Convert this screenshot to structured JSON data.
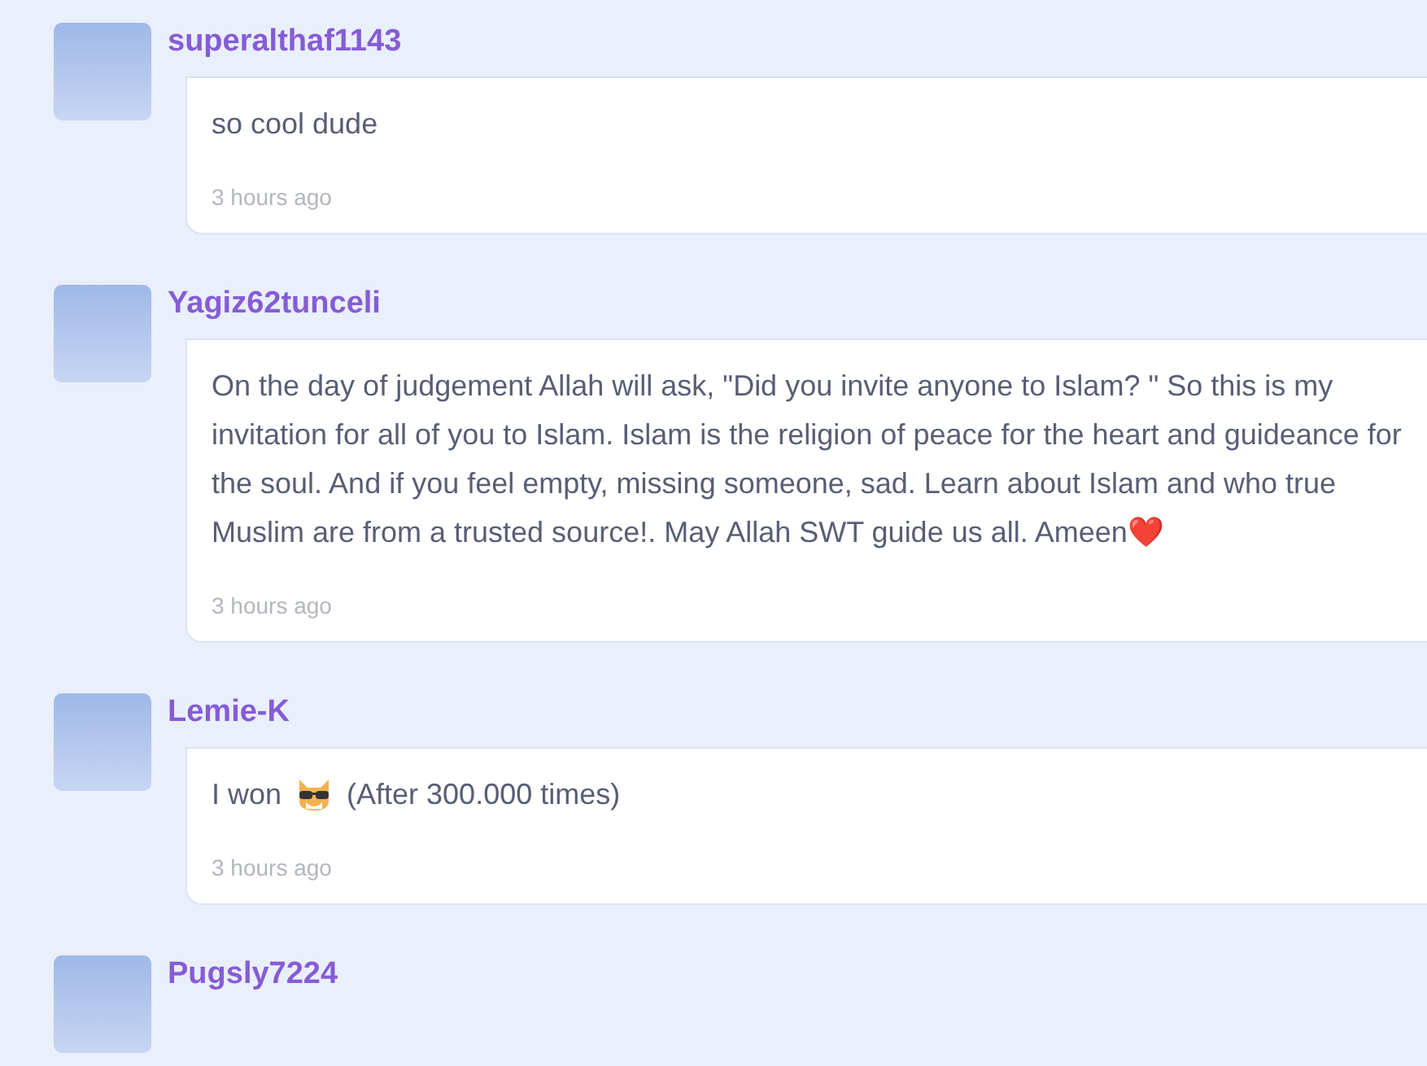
{
  "comments": [
    {
      "username": "superalthaf1143",
      "body": [
        {
          "kind": "text",
          "text": "so cool dude"
        }
      ],
      "time": "3 hours ago"
    },
    {
      "username": "Yagiz62tunceli",
      "body": [
        {
          "kind": "text",
          "text": "On the day of judgement Allah will ask, \"Did you invite anyone to Islam? \" So this is my invitation for all of you to Islam. Islam is the religion of peace for the heart and guideance for the soul. And if you feel empty, missing someone, sad. Learn about Islam and who true Muslim are from a trusted source!. May Allah SWT guide us all. Ameen❤️"
        }
      ],
      "time": "3 hours ago"
    },
    {
      "username": "Lemie-K",
      "body": [
        {
          "kind": "text",
          "text": "I won"
        },
        {
          "kind": "emoji"
        },
        {
          "kind": "text",
          "text": "(After 300.000 times)"
        }
      ],
      "time": "3 hours ago"
    },
    {
      "username": "Pugsly7224"
    }
  ]
}
